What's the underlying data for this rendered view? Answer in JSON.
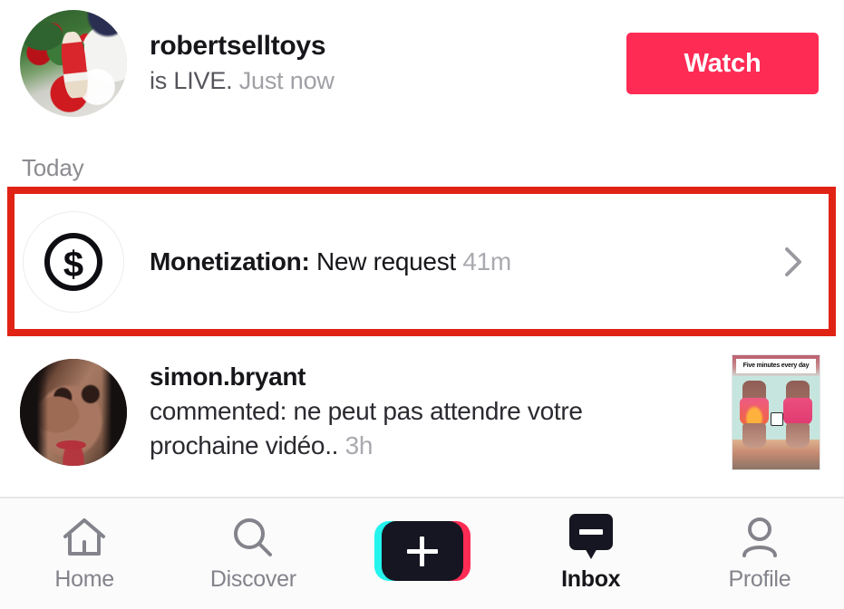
{
  "live": {
    "avatar_name": "christmas-santa-avatar",
    "username": "robertselltoys",
    "status": "is LIVE.",
    "time": "Just now",
    "watch_label": "Watch",
    "watch_color": "#fe2c55"
  },
  "section": {
    "today_label": "Today"
  },
  "highlight": {
    "color": "#e02315"
  },
  "monetization": {
    "icon_name": "dollar-coin-icon",
    "label": "Monetization:",
    "body": " New request ",
    "time": "41m",
    "chevron_name": "chevron-right-icon"
  },
  "comment": {
    "avatar_name": "woman-portrait-avatar",
    "username": "simon.bryant",
    "line1": "commented: ne peut pas attendre votre",
    "line2": "prochaine vidéo.. ",
    "time": "3h",
    "thumbnail_caption": "Five minutes every day"
  },
  "tabbar": {
    "items": [
      {
        "label": "Home",
        "icon": "home-icon",
        "active": false
      },
      {
        "label": "Discover",
        "icon": "search-icon",
        "active": false
      },
      {
        "label": "",
        "icon": "create-plus-icon",
        "active": false
      },
      {
        "label": "Inbox",
        "icon": "inbox-bubble-icon",
        "active": true
      },
      {
        "label": "Profile",
        "icon": "person-icon",
        "active": false
      }
    ]
  }
}
